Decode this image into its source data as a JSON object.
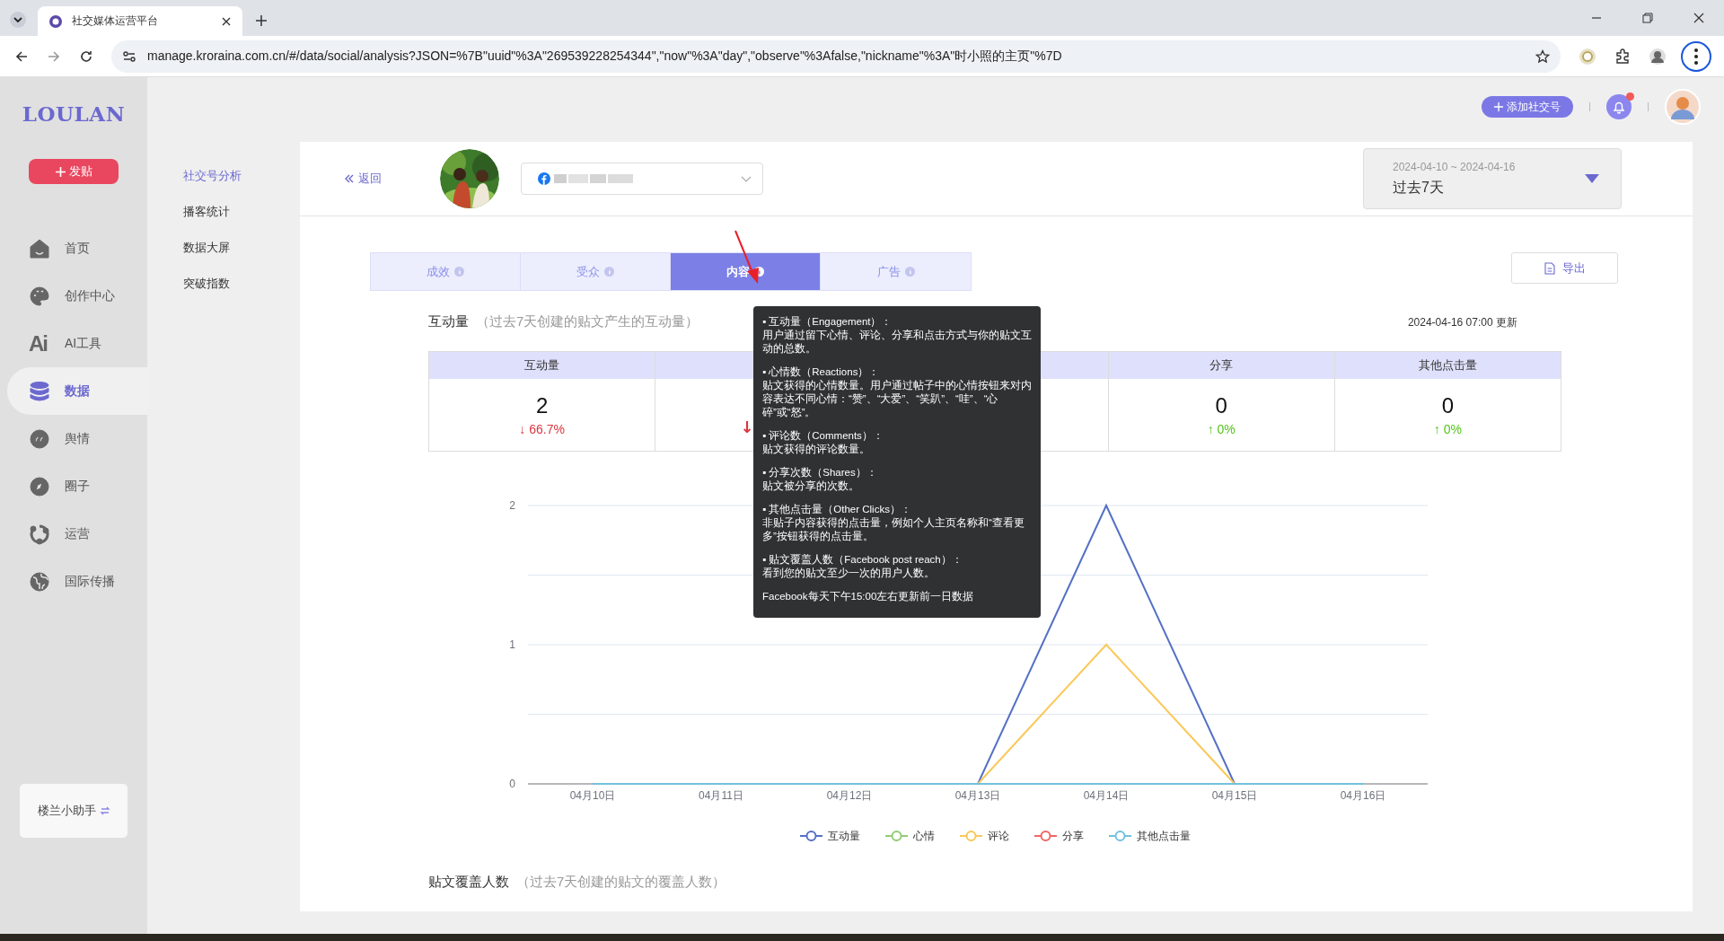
{
  "browser": {
    "tab_title": "社交媒体运营平台",
    "url": "manage.kroraina.com.cn/#/data/social/analysis?JSON=%7B\"uuid\"%3A\"269539228254344\",\"now\"%3A\"day\",\"observe\"%3Afalse,\"nickname\"%3A\"时小照的主页\"%7D"
  },
  "sidebar": {
    "logo": "LOULAN",
    "post_button": "发贴",
    "items": [
      {
        "label": "首页",
        "selected": false
      },
      {
        "label": "创作中心",
        "selected": false
      },
      {
        "label": "AI工具",
        "glyph": "Ai",
        "selected": false
      },
      {
        "label": "数据",
        "selected": true
      },
      {
        "label": "舆情",
        "selected": false
      },
      {
        "label": "圈子",
        "selected": false
      },
      {
        "label": "运营",
        "selected": false
      },
      {
        "label": "国际传播",
        "selected": false
      }
    ],
    "assistant": "楼兰小助手"
  },
  "subnav": {
    "items": [
      {
        "label": "社交号分析",
        "selected": true
      },
      {
        "label": "播客统计",
        "selected": false
      },
      {
        "label": "数据大屏",
        "selected": false
      },
      {
        "label": "突破指数",
        "selected": false
      }
    ]
  },
  "topbar": {
    "add_button": "添加社交号",
    "notification_dot": true
  },
  "header": {
    "back": "返回",
    "date_range": "2024-04-10 ~ 2024-04-16",
    "period": "过去7天"
  },
  "tabs": [
    {
      "label": "成效",
      "selected": false
    },
    {
      "label": "受众",
      "selected": false
    },
    {
      "label": "内容",
      "selected": true
    },
    {
      "label": "广告",
      "selected": false
    }
  ],
  "export_button": "导出",
  "engagement": {
    "title": "互动量",
    "subtitle": "（过去7天创建的贴文产生的互动量）",
    "updated": "2024-04-16 07:00 更新",
    "stats": [
      {
        "kind": "metric",
        "label": "互动量",
        "value": "2",
        "change": "↓ 66.7%",
        "color": "#d9363e"
      },
      {
        "kind": "covered",
        "change": "↓",
        "color": "#d9363e"
      },
      {
        "kind": "covered"
      },
      {
        "kind": "metric",
        "label": "分享",
        "value": "0",
        "change": "↑ 0%",
        "color": "#52c41a"
      },
      {
        "kind": "metric",
        "label": "其他点击量",
        "value": "0",
        "change": "↑ 0%",
        "color": "#52c41a"
      }
    ],
    "chart_data": {
      "type": "line",
      "categories": [
        "04月10日",
        "04月11日",
        "04月12日",
        "04月13日",
        "04月14日",
        "04月15日",
        "04月16日"
      ],
      "ylim": [
        0,
        2
      ],
      "yticks": [
        0,
        1,
        2
      ],
      "series": [
        {
          "name": "互动量",
          "color": "#5470c6",
          "values": [
            null,
            null,
            null,
            0,
            2,
            0,
            null
          ]
        },
        {
          "name": "心情",
          "color": "#91cc75",
          "values": [
            null,
            null,
            null,
            null,
            null,
            null,
            null
          ]
        },
        {
          "name": "评论",
          "color": "#fac858",
          "values": [
            null,
            null,
            null,
            0,
            1,
            0,
            null
          ]
        },
        {
          "name": "分享",
          "color": "#ee6666",
          "values": [
            null,
            null,
            null,
            null,
            null,
            null,
            null
          ]
        },
        {
          "name": "其他点击量",
          "color": "#73c0de",
          "values": [
            0,
            0,
            0,
            0,
            0,
            0,
            0
          ]
        }
      ]
    }
  },
  "tooltip": {
    "sections": [
      {
        "heading": "▪ 互动量（Engagement）：",
        "body": "用户通过留下心情、评论、分享和点击方式与你的贴文互动的总数。"
      },
      {
        "heading": "▪ 心情数（Reactions）：",
        "body": "贴文获得的心情数量。用户通过帖子中的心情按钮来对内容表达不同心情：“赞”、“大爱”、“笑趴”、“哇”、“心碎”或“怒”。"
      },
      {
        "heading": "▪ 评论数（Comments）：",
        "body": "贴文获得的评论数量。"
      },
      {
        "heading": "▪ 分享次数（Shares）：",
        "body": "贴文被分享的次数。"
      },
      {
        "heading": "▪ 其他点击量（Other Clicks）：",
        "body": "非贴子内容获得的点击量，例如个人主页名称和“查看更多”按钮获得的点击量。"
      },
      {
        "heading": "▪ 贴文覆盖人数（Facebook post reach）：",
        "body": "看到您的贴文至少一次的用户人数。"
      }
    ],
    "note": "Facebook每天下午15:00左右更新前一日数据"
  },
  "reach": {
    "title": "贴文覆盖人数",
    "subtitle": "（过去7天创建的贴文的覆盖人数）"
  }
}
